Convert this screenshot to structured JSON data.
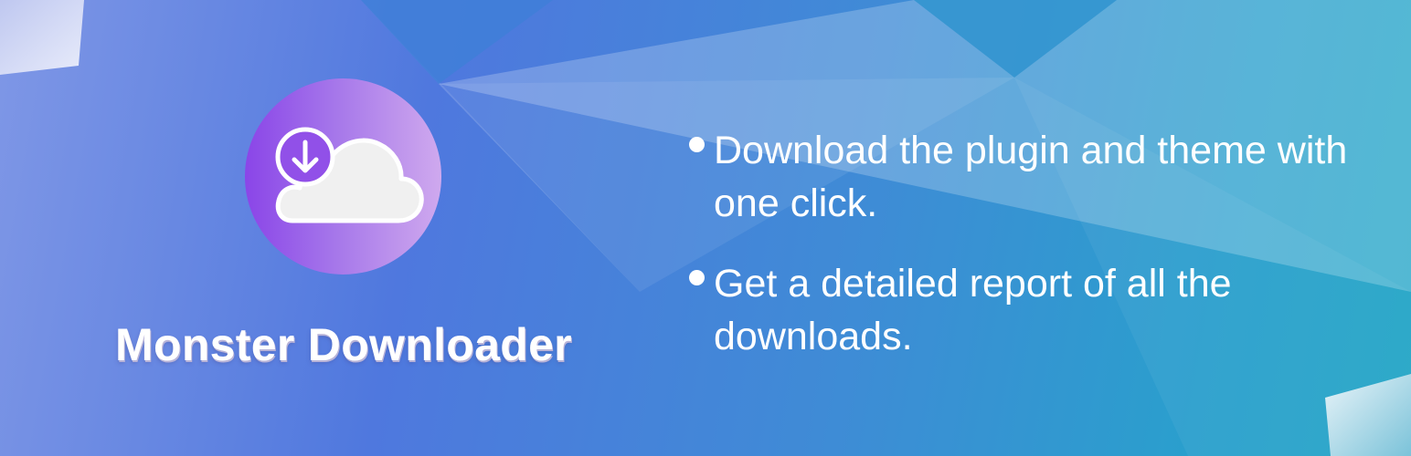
{
  "colors": {
    "gradient_left": "#7f97e6",
    "gradient_mid": "#4f78de",
    "gradient_right": "#22a6c6",
    "logo_purple": "#8a45e8",
    "logo_lilac": "#cfa9ee",
    "text": "#ffffff"
  },
  "logo": {
    "icon": "cloud-download-icon"
  },
  "product": {
    "title": "Monster Downloader"
  },
  "features": [
    {
      "text": "Download the plugin and theme with one click."
    },
    {
      "text": "Get a detailed report of all the downloads."
    }
  ]
}
